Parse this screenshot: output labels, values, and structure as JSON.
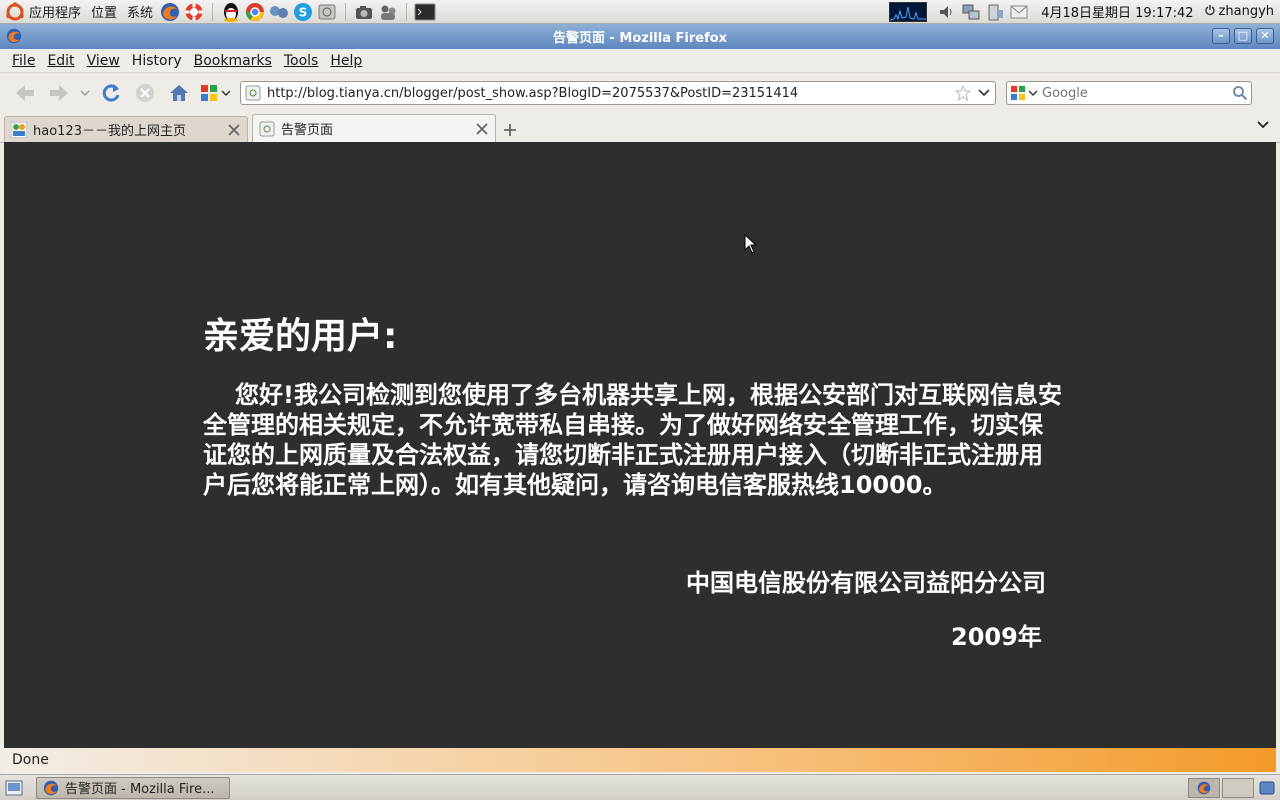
{
  "top_panel": {
    "applications": "应用程序",
    "places": "位置",
    "system": "系统",
    "clock": "4月18日星期日 19:17:42",
    "user": "zhangyh"
  },
  "window": {
    "title": "告警页面 - Mozilla Firefox"
  },
  "menubar": {
    "file": "File",
    "edit": "Edit",
    "view": "View",
    "history": "History",
    "bookmarks": "Bookmarks",
    "tools": "Tools",
    "help": "Help"
  },
  "navbar": {
    "url": "http://blog.tianya.cn/blogger/post_show.asp?BlogID=2075537&PostID=23151414",
    "search_placeholder": "Google"
  },
  "tabs": [
    {
      "label": "hao123－－我的上网主页",
      "active": false
    },
    {
      "label": "告警页面",
      "active": true
    }
  ],
  "page": {
    "title": "亲爱的用户:",
    "body": "您好!我公司检测到您使用了多台机器共享上网，根据公安部门对互联网信息安全管理的相关规定，不允许宽带私自串接。为了做好网络安全管理工作，切实保证您的上网质量及合法权益，请您切断非正式注册用户接入（切断非正式注册用户后您将能正常上网）。如有其他疑问，请咨询电信客服热线10000。",
    "signer": "中国电信股份有限公司益阳分公司",
    "date": "2009年"
  },
  "statusbar": {
    "text": "Done"
  },
  "bottom_panel": {
    "task_label": "告警页面 - Mozilla Fire..."
  },
  "colors": {
    "page_background": "#2e2e2e",
    "notice_text": "#ffffff",
    "titlebar": "#6f94c9"
  }
}
